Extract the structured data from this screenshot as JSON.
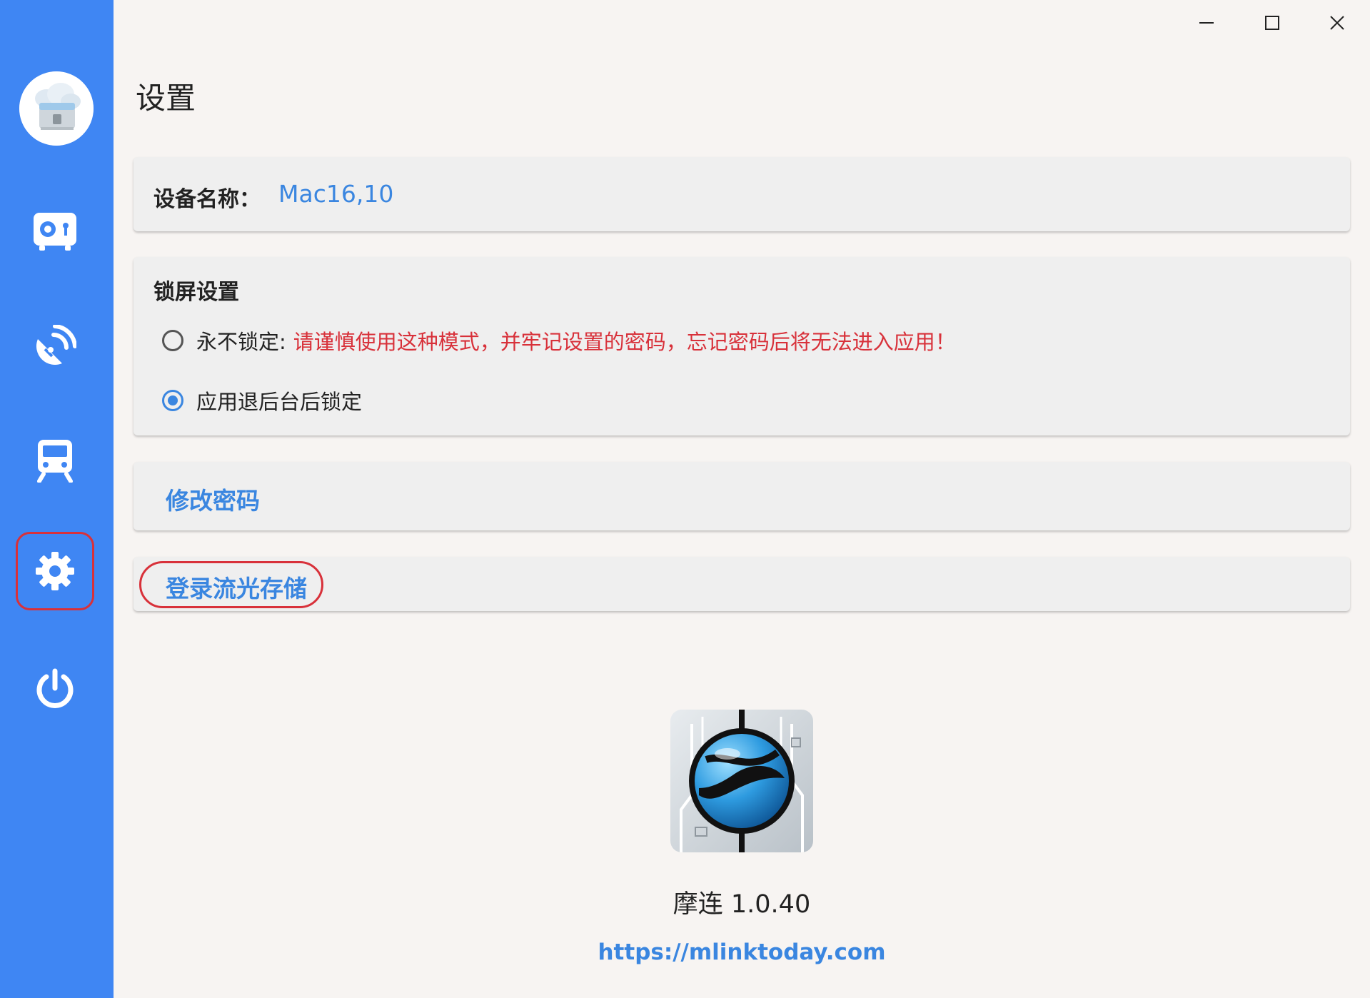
{
  "window": {
    "controls": [
      "minimize",
      "maximize",
      "close"
    ]
  },
  "sidebar": {
    "items": [
      {
        "name": "safe-box",
        "icon": "safe-icon"
      },
      {
        "name": "satellite",
        "icon": "satellite-dish-icon"
      },
      {
        "name": "train",
        "icon": "train-icon"
      },
      {
        "name": "settings",
        "icon": "gear-icon",
        "highlighted": true
      },
      {
        "name": "power",
        "icon": "power-icon"
      }
    ]
  },
  "page": {
    "title": "设置"
  },
  "device": {
    "label": "设备名称：",
    "value": "Mac16,10"
  },
  "lock": {
    "title": "锁屏设置",
    "never_label": "永不锁定:",
    "never_warning": "请谨慎使用这种模式，并牢记设置的密码，忘记密码后将无法进入应用！",
    "background_label": "应用退后台后锁定",
    "selected": "background"
  },
  "actions": {
    "change_password": "修改密码",
    "login_storage": "登录流光存储"
  },
  "about": {
    "version": "摩连 1.0.40",
    "url": "https://mlinktoday.com"
  },
  "colors": {
    "sidebar": "#3f86f3",
    "accent": "#3a86e0",
    "warning": "#d8313a",
    "background": "#f7f4f2",
    "card": "#efefef"
  }
}
